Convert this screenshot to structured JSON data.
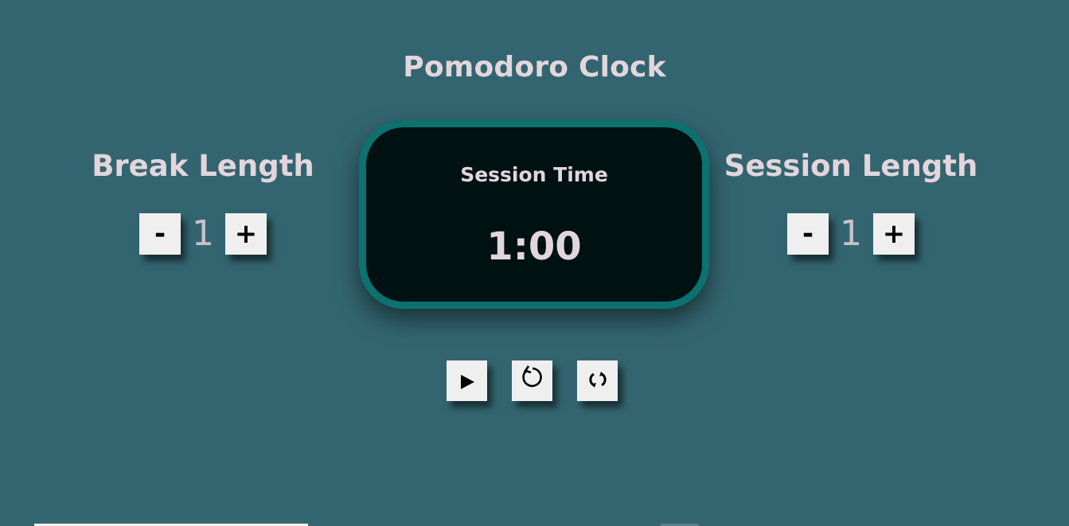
{
  "app": {
    "title": "Pomodoro Clock"
  },
  "break": {
    "label": "Break Length",
    "value": "1",
    "decrement_label": "-",
    "increment_label": "+"
  },
  "session": {
    "label": "Session Length",
    "value": "1",
    "decrement_label": "-",
    "increment_label": "+"
  },
  "timer": {
    "label": "Session Time",
    "time": "1:00"
  },
  "playback": {
    "buttons": [
      {
        "icon": "play-icon",
        "glyph": "▶"
      },
      {
        "icon": "restart-icon",
        "glyph": "↺"
      },
      {
        "icon": "reset-icon",
        "glyph": "⟲"
      }
    ]
  },
  "colors": {
    "background": "#336570",
    "clock_face": "#001112",
    "clock_border": "#0b7270",
    "text": "#e2d6dc",
    "button": "#efefef"
  }
}
